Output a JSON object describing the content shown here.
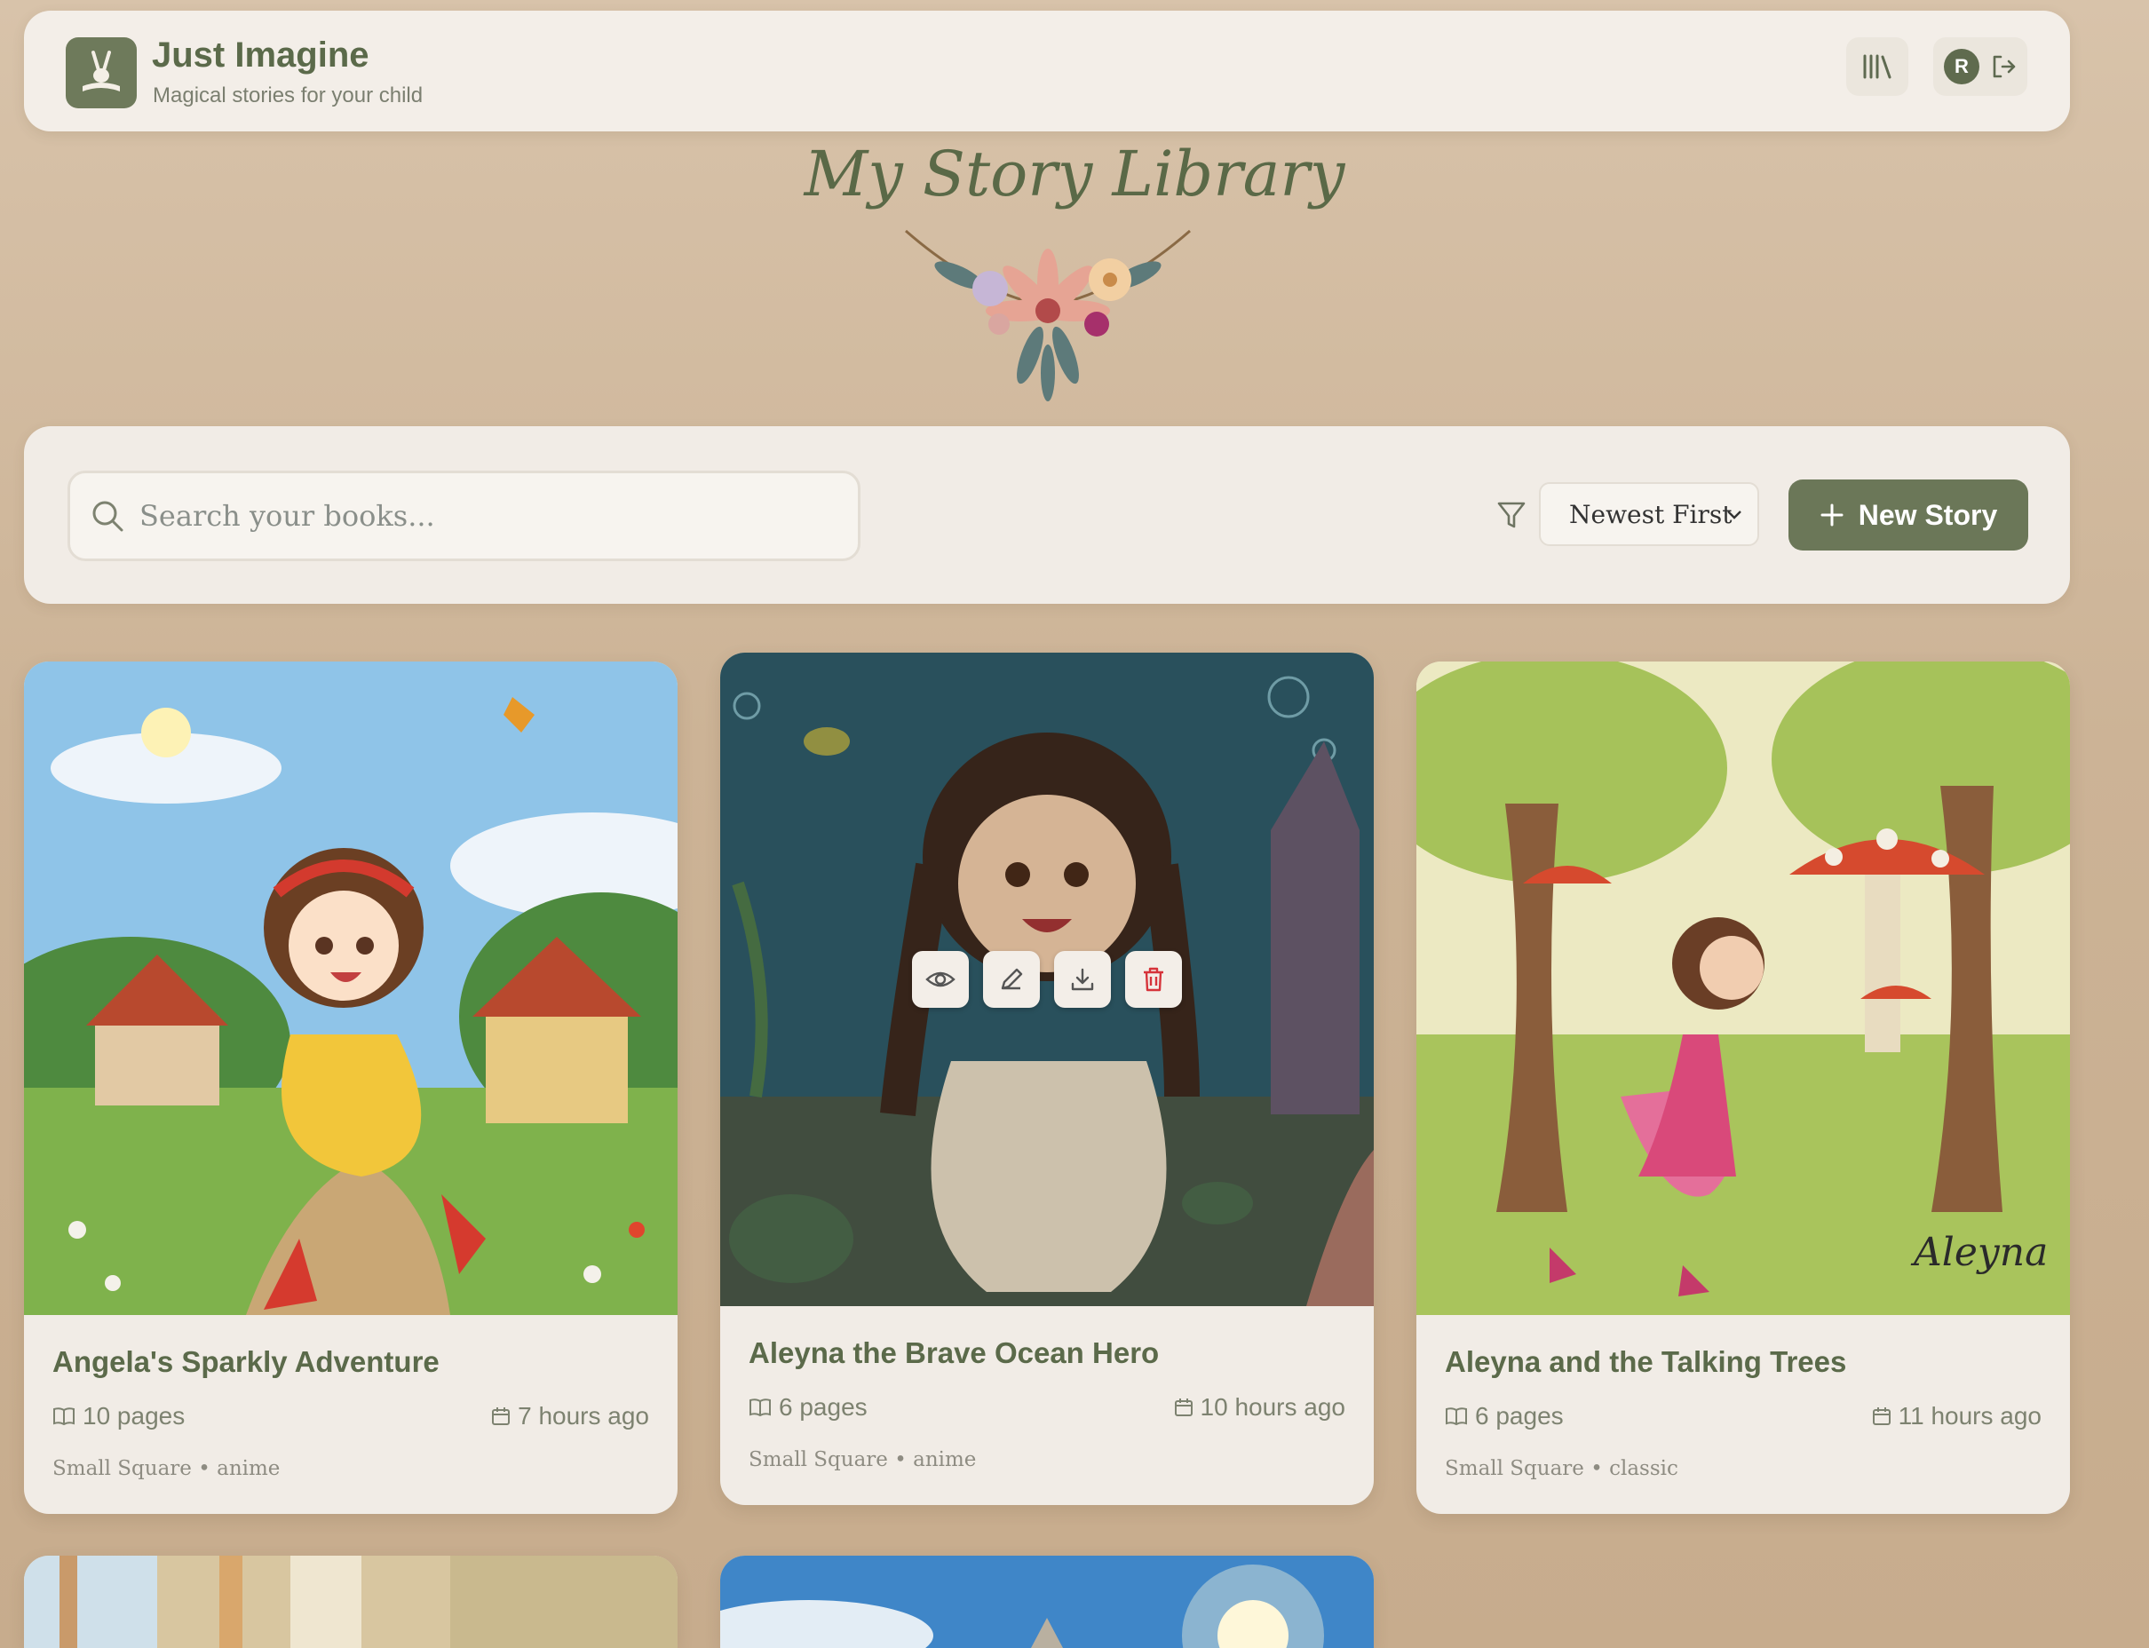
{
  "header": {
    "app_title": "Just Imagine",
    "app_subtitle": "Magical stories for your child",
    "avatar_initial": "R"
  },
  "page_title": "My Story Library",
  "toolbar": {
    "search_placeholder": "Search your books...",
    "sort_value": "Newest First",
    "new_story_label": "New Story"
  },
  "books": [
    {
      "title": "Angela's Sparkly Adventure",
      "pages": "10 pages",
      "time": "7 hours ago",
      "tags": "Small Square • anime"
    },
    {
      "title": "Aleyna the Brave Ocean Hero",
      "pages": "6 pages",
      "time": "10 hours ago",
      "tags": "Small Square • anime"
    },
    {
      "title": "Aleyna and the Talking Trees",
      "pages": "6 pages",
      "time": "11 hours ago",
      "tags": "Small Square • classic",
      "signature": "Aleyna"
    }
  ],
  "colors": {
    "accent": "#6b7758",
    "background": "#ccb396",
    "card": "#f1ece6",
    "delete": "#d6333a"
  }
}
